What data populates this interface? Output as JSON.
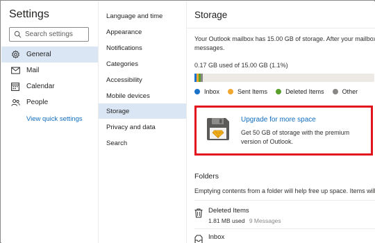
{
  "left_pane": {
    "title": "Settings",
    "search": {
      "placeholder": "Search settings"
    },
    "nav": [
      {
        "label": "General",
        "icon": "gear-icon",
        "active": true
      },
      {
        "label": "Mail",
        "icon": "mail-icon",
        "active": false
      },
      {
        "label": "Calendar",
        "icon": "calendar-icon",
        "active": false
      },
      {
        "label": "People",
        "icon": "people-icon",
        "active": false
      }
    ],
    "quick_link": "View quick settings"
  },
  "middle_pane": {
    "items": [
      {
        "label": "Language and time",
        "active": false
      },
      {
        "label": "Appearance",
        "active": false
      },
      {
        "label": "Notifications",
        "active": false
      },
      {
        "label": "Categories",
        "active": false
      },
      {
        "label": "Accessibility",
        "active": false
      },
      {
        "label": "Mobile devices",
        "active": false
      },
      {
        "label": "Storage",
        "active": true
      },
      {
        "label": "Privacy and data",
        "active": false
      },
      {
        "label": "Search",
        "active": false
      }
    ]
  },
  "storage": {
    "title": "Storage",
    "description_line1": "Your Outlook mailbox has 15.00 GB of storage. After your mailbox",
    "description_line2": "messages.",
    "usage_text": "0.17 GB used of 15.00 GB (1.1%)",
    "bar_segments": [
      {
        "name": "Inbox",
        "fraction": 0.012,
        "color": "#1a73c9"
      },
      {
        "name": "Sent Items",
        "fraction": 0.009,
        "color": "#f0a830"
      },
      {
        "name": "Deleted Items",
        "fraction": 0.008,
        "color": "#5aa02c"
      },
      {
        "name": "Other",
        "fraction": 0.012,
        "color": "#8a8886"
      }
    ],
    "legend": [
      {
        "label": "Inbox",
        "color": "#1a73c9"
      },
      {
        "label": "Sent Items",
        "color": "#f0a830"
      },
      {
        "label": "Deleted Items",
        "color": "#5aa02c"
      },
      {
        "label": "Other",
        "color": "#8a8886"
      }
    ],
    "upgrade": {
      "title": "Upgrade for more space",
      "description": "Get 50 GB of storage with the premium version of Outlook.",
      "icon": "floppy-disk-premium-icon",
      "highlight_color": "#e1141e"
    },
    "folders": {
      "title": "Folders",
      "description": "Emptying contents from a folder will help free up space. Items will",
      "items": [
        {
          "name": "Deleted Items",
          "size": "1.81 MB used",
          "count": "9 Messages",
          "icon": "trash-icon"
        },
        {
          "name": "Inbox",
          "size": "",
          "count": "",
          "icon": "inbox-icon"
        }
      ]
    }
  },
  "colors": {
    "accent": "#0f6cbd",
    "selected_bg": "#dae6f4"
  }
}
